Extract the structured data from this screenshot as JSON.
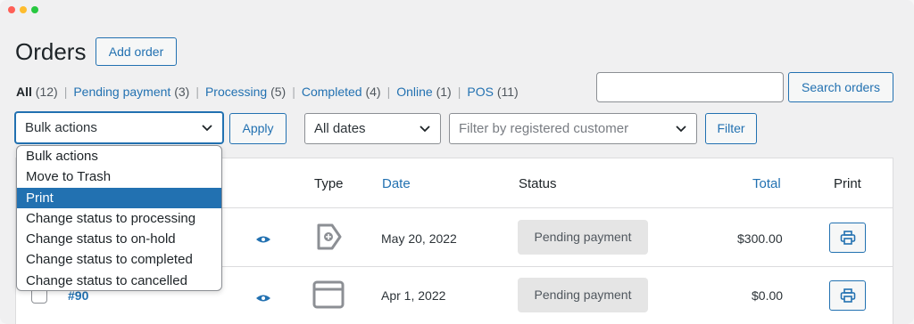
{
  "page": {
    "title": "Orders",
    "add_order_label": "Add order"
  },
  "filters_nav": [
    {
      "label": "All",
      "count": "(12)",
      "current": true
    },
    {
      "label": "Pending payment",
      "count": "(3)"
    },
    {
      "label": "Processing",
      "count": "(5)"
    },
    {
      "label": "Completed",
      "count": "(4)"
    },
    {
      "label": "Online",
      "count": "(1)"
    },
    {
      "label": "POS",
      "count": "(11)"
    }
  ],
  "search": {
    "value": "",
    "button_label": "Search orders"
  },
  "toolbar": {
    "bulk_actions_value": "Bulk actions",
    "apply_label": "Apply",
    "dates_value": "All dates",
    "customer_placeholder": "Filter by registered customer",
    "filter_label": "Filter"
  },
  "bulk_dropdown": {
    "options": [
      "Bulk actions",
      "Move to Trash",
      "Print",
      "Change status to processing",
      "Change status to on-hold",
      "Change status to completed",
      "Change status to cancelled"
    ],
    "highlighted_index": 2
  },
  "table": {
    "headers": {
      "type": "Type",
      "date": "Date",
      "status": "Status",
      "total": "Total",
      "print": "Print"
    },
    "rows": [
      {
        "order": "",
        "type_icon": "pos-tag-icon",
        "date": "May 20, 2022",
        "status": "Pending payment",
        "total": "$300.00"
      },
      {
        "order": "#90",
        "type_icon": "browser-window-icon",
        "date": "Apr 1, 2022",
        "status": "Pending payment",
        "total": "$0.00"
      }
    ]
  },
  "colors": {
    "accent": "#2271b1",
    "badge_bg": "#e5e5e5",
    "background": "#f0f0f1"
  }
}
